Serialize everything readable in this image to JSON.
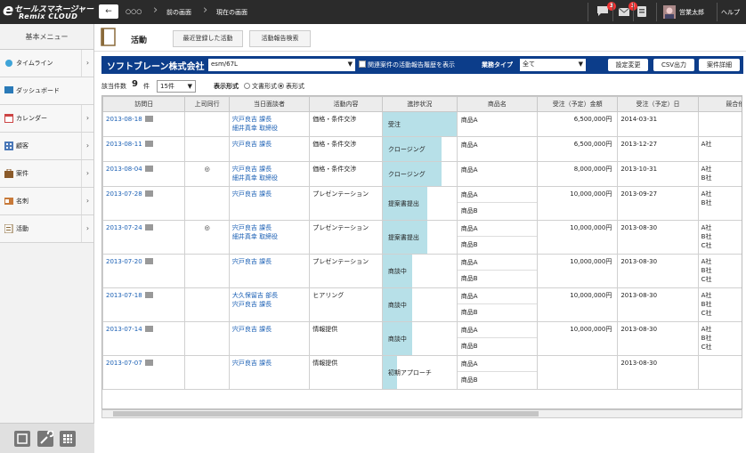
{
  "app": {
    "logo_line1": "セールスマネージャー",
    "logo_line2": "Remix CLOUD"
  },
  "topbar": {
    "breadcrumb": [
      "○○○",
      "前の画面",
      "現在の画面"
    ],
    "badge_messages": "3",
    "badge_mail": "3",
    "user": "営業太郎",
    "help": "ヘルプ"
  },
  "sidebar": {
    "header": "基本メニュー",
    "items": [
      {
        "label": "タイムライン",
        "icon": "timeline-icon"
      },
      {
        "label": "ダッシュボード",
        "icon": "dashboard-icon"
      },
      {
        "label": "カレンダー",
        "icon": "calendar-icon"
      },
      {
        "label": "顧客",
        "icon": "customer-icon"
      },
      {
        "label": "案件",
        "icon": "deal-icon"
      },
      {
        "label": "名刺",
        "icon": "business-card-icon"
      },
      {
        "label": "活動",
        "icon": "activity-icon"
      }
    ]
  },
  "page": {
    "title": "活動",
    "tabs": [
      "最近登録した活動",
      "活動報告検索"
    ]
  },
  "filter": {
    "company": "ソフトブレーン株式会社",
    "deal_select": "esm/67L",
    "related_checkbox": "関連案件の活動報告履歴を表示",
    "business_type_label": "業務タイプ",
    "business_type": "全て",
    "buttons": [
      "設定変更",
      "CSV出力",
      "案件詳細"
    ]
  },
  "list": {
    "count_label": "該当件数",
    "count": "9",
    "count_unit": "件",
    "per_page": "15件",
    "format_label": "表示形式",
    "format_options": [
      "文書形式",
      "表形式"
    ],
    "format_selected": "表形式"
  },
  "table": {
    "columns": [
      "訪問日",
      "上司同行",
      "当日面談者",
      "活動内容",
      "進捗状況",
      "商品名",
      "受注（予定）金額",
      "受注（予定）日",
      "競合他社"
    ],
    "rows": [
      {
        "date": "2013-08-18",
        "boss": "",
        "people": [
          "宍戸良吉 課長",
          "細井真幸 取締役"
        ],
        "content": "価格・条件交渉",
        "progress": "受注",
        "progress_level": 1.0,
        "products": [
          "商品A"
        ],
        "amount": "6,500,000円",
        "order_date": "2014-03-31",
        "competitors": []
      },
      {
        "date": "2013-08-11",
        "boss": "",
        "people": [
          "宍戸良吉 課長"
        ],
        "content": "価格・条件交渉",
        "progress": "クロージング",
        "progress_level": 0.8,
        "products": [
          "商品A"
        ],
        "amount": "6,500,000円",
        "order_date": "2013-12-27",
        "competitors": [
          "A社"
        ]
      },
      {
        "date": "2013-08-04",
        "boss": "◎",
        "people": [
          "宍戸良吉 課長",
          "細井真幸 取締役"
        ],
        "content": "価格・条件交渉",
        "progress": "クロージング",
        "progress_level": 0.8,
        "products": [
          "商品A"
        ],
        "amount": "8,000,000円",
        "order_date": "2013-10-31",
        "competitors": [
          "A社",
          "B社"
        ]
      },
      {
        "date": "2013-07-28",
        "boss": "",
        "people": [
          "宍戸良吉 課長"
        ],
        "content": "プレゼンテーション",
        "progress": "提案書提出",
        "progress_level": 0.6,
        "products": [
          "商品A",
          "商品B"
        ],
        "amount": "10,000,000円",
        "order_date": "2013-09-27",
        "competitors": [
          "A社",
          "B社"
        ]
      },
      {
        "date": "2013-07-24",
        "boss": "◎",
        "people": [
          "宍戸良吉 課長",
          "細井真幸 取締役"
        ],
        "content": "プレゼンテーション",
        "progress": "提案書提出",
        "progress_level": 0.6,
        "products": [
          "商品A",
          "商品B"
        ],
        "amount": "10,000,000円",
        "order_date": "2013-08-30",
        "competitors": [
          "A社",
          "B社",
          "C社"
        ]
      },
      {
        "date": "2013-07-20",
        "boss": "",
        "people": [
          "宍戸良吉 課長"
        ],
        "content": "プレゼンテーション",
        "progress": "商談中",
        "progress_level": 0.4,
        "products": [
          "商品A",
          "商品B"
        ],
        "amount": "10,000,000円",
        "order_date": "2013-08-30",
        "competitors": [
          "A社",
          "B社",
          "C社"
        ]
      },
      {
        "date": "2013-07-18",
        "boss": "",
        "people": [
          "大久保留吉 部長",
          "宍戸良吉 課長"
        ],
        "content": "ヒアリング",
        "progress": "商談中",
        "progress_level": 0.4,
        "products": [
          "商品A",
          "商品B"
        ],
        "amount": "10,000,000円",
        "order_date": "2013-08-30",
        "competitors": [
          "A社",
          "B社",
          "C社"
        ]
      },
      {
        "date": "2013-07-14",
        "boss": "",
        "people": [
          "宍戸良吉 課長"
        ],
        "content": "情報提供",
        "progress": "商談中",
        "progress_level": 0.4,
        "products": [
          "商品A",
          "商品B"
        ],
        "amount": "10,000,000円",
        "order_date": "2013-08-30",
        "competitors": [
          "A社",
          "B社",
          "C社"
        ]
      },
      {
        "date": "2013-07-07",
        "boss": "",
        "people": [
          "宍戸良吉 課長"
        ],
        "content": "情報提供",
        "progress": "初期アプローチ",
        "progress_level": 0.2,
        "products": [
          "商品A",
          "商品B"
        ],
        "amount": "",
        "order_date": "2013-08-30",
        "competitors": []
      }
    ]
  }
}
